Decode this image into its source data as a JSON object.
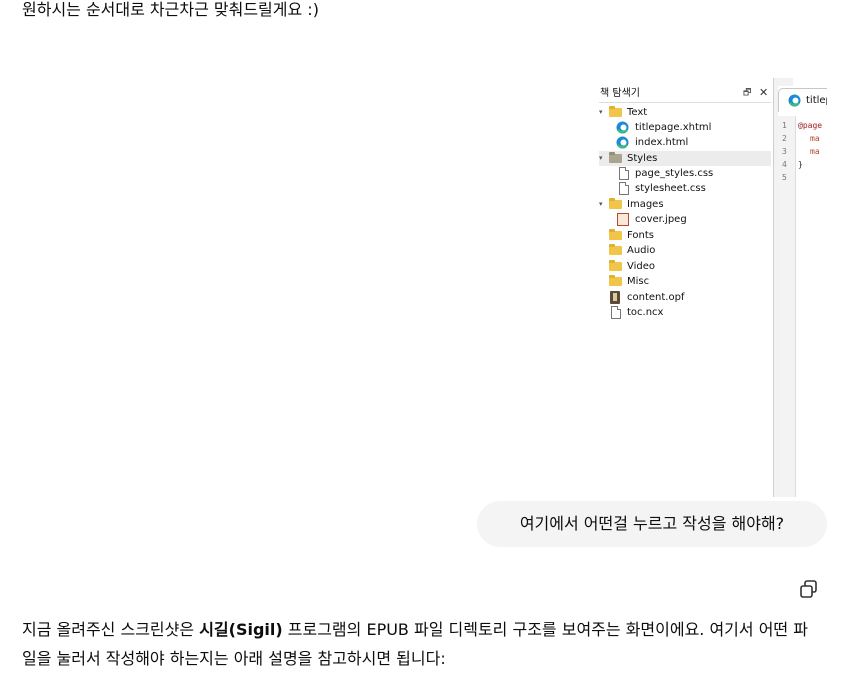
{
  "top_message": "원하시는 순서대로 차근차근 맞춰드릴게요 :)",
  "screenshot": {
    "pane_title": "책 탐색기",
    "float_glyph": "🗗",
    "close_glyph": "✕",
    "tree": [
      {
        "label": "Text",
        "type": "folder",
        "expanded": true
      },
      {
        "label": "titlepage.xhtml",
        "type": "edge-file"
      },
      {
        "label": "index.html",
        "type": "edge-file"
      },
      {
        "label": "Styles",
        "type": "folder-gray",
        "expanded": true,
        "selected": true
      },
      {
        "label": "page_styles.css",
        "type": "file"
      },
      {
        "label": "stylesheet.css",
        "type": "file"
      },
      {
        "label": "Images",
        "type": "folder",
        "expanded": true
      },
      {
        "label": "cover.jpeg",
        "type": "image-file"
      },
      {
        "label": "Fonts",
        "type": "folder"
      },
      {
        "label": "Audio",
        "type": "folder"
      },
      {
        "label": "Video",
        "type": "folder"
      },
      {
        "label": "Misc",
        "type": "folder"
      },
      {
        "label": "content.opf",
        "type": "book-file"
      },
      {
        "label": "toc.ncx",
        "type": "file"
      }
    ],
    "editor_tab_label": "titlep",
    "line_numbers": [
      "1",
      "2",
      "3",
      "4",
      "5"
    ],
    "code_lines": [
      "@page",
      "ma",
      "ma",
      "}"
    ]
  },
  "user_message": "여기에서 어떤걸 누르고 작성을 해야해?",
  "answer": {
    "part1": "지금 올려주신 스크린샷은 ",
    "bold": "시길(Sigil)",
    "part2": " 프로그램의 EPUB 파일 디렉토리 구조를 보여주는 화면이에요. 여기서 어떤 파일을 눌러서 작성해야 하는지는 아래 설명을 참고하시면 됩니다:"
  },
  "colors": {
    "bubble": "#f4f4f4",
    "folder": "#f0c54a",
    "text": "#0d0d0d"
  }
}
